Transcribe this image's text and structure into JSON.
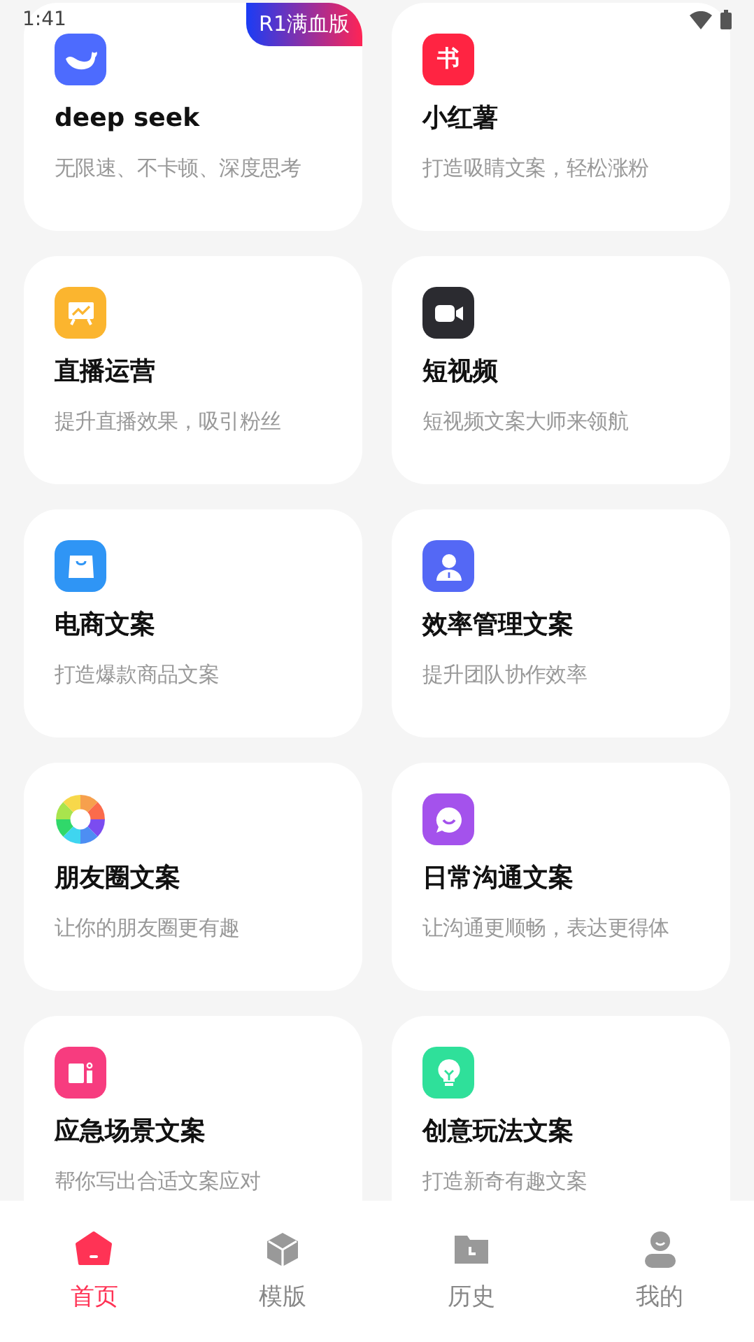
{
  "status_bar": {
    "time": "1:41"
  },
  "cards": [
    {
      "title": "deep seek",
      "subtitle": "无限速、不卡顿、深度思考",
      "color": "#4d6bfe",
      "badge": "R1满血版"
    },
    {
      "title": "小红薯",
      "subtitle": "打造吸睛文案，轻松涨粉",
      "icon_text": "书",
      "color": "#ff2442"
    },
    {
      "title": "直播运营",
      "subtitle": "提升直播效果，吸引粉丝",
      "color": "#fbb52f"
    },
    {
      "title": "短视频",
      "subtitle": "短视频文案大师来领航",
      "color": "#2b2b30"
    },
    {
      "title": "电商文案",
      "subtitle": "打造爆款商品文案",
      "color": "#2f95f5"
    },
    {
      "title": "效率管理文案",
      "subtitle": "提升团队协作效率",
      "color": "#5468f5"
    },
    {
      "title": "朋友圈文案",
      "subtitle": "让你的朋友圈更有趣"
    },
    {
      "title": "日常沟通文案",
      "subtitle": "让沟通更顺畅，表达更得体",
      "color": "#a452ec"
    },
    {
      "title": "应急场景文案",
      "subtitle": "帮你写出合适文案应对",
      "color": "#f73c7f"
    },
    {
      "title": "创意玩法文案",
      "subtitle": "打造新奇有趣文案",
      "color": "#2fe09a"
    }
  ],
  "nav": [
    {
      "label": "首页",
      "selected": true
    },
    {
      "label": "模版",
      "selected": false
    },
    {
      "label": "历史",
      "selected": false
    },
    {
      "label": "我的",
      "selected": false
    }
  ]
}
